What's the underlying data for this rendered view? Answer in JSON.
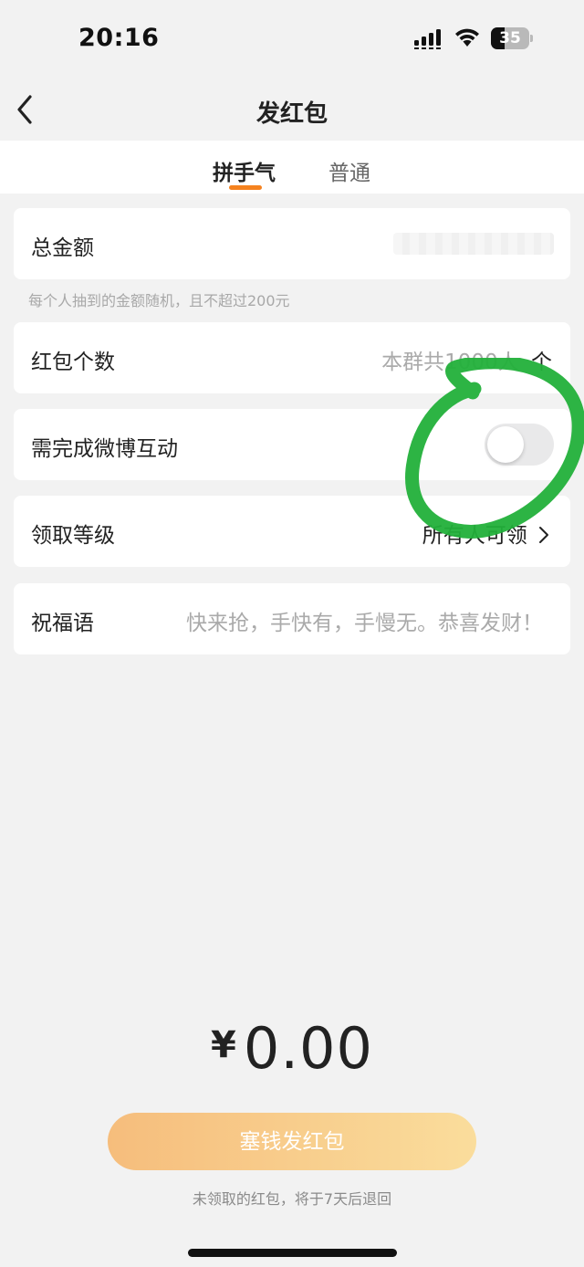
{
  "status_bar": {
    "time": "20:16",
    "battery": "35",
    "battery_level": 0.35
  },
  "nav": {
    "title": "发红包",
    "back_icon": "chevron-left-icon"
  },
  "tabs": [
    {
      "label": "拼手气",
      "active": true
    },
    {
      "label": "普通",
      "active": false
    }
  ],
  "form": {
    "total_amount": {
      "label": "总金额",
      "value": ""
    },
    "hint": "每个人抽到的金额随机，且不超过200元",
    "count": {
      "label": "红包个数",
      "placeholder": "本群共1000人",
      "unit": "个"
    },
    "weibo_interaction": {
      "label": "需完成微博互动",
      "enabled": false
    },
    "claim_level": {
      "label": "领取等级",
      "value": "所有人可领"
    },
    "blessing": {
      "label": "祝福语",
      "placeholder": "快来抢，手快有，手慢无。恭喜发财！"
    }
  },
  "summary": {
    "currency": "¥",
    "amount": "0.00"
  },
  "submit": {
    "label": "塞钱发红包"
  },
  "footer_note": "未领取的红包，将于7天后退回",
  "colors": {
    "accent": "#f5821f",
    "annotation": "#22b03a",
    "button_start": "#f6bd7c",
    "button_end": "#fadd9c"
  }
}
